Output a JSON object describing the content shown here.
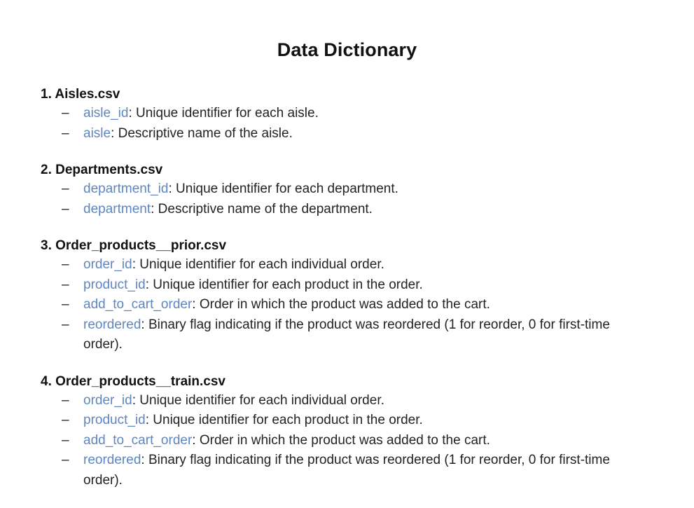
{
  "document": {
    "title": "Data Dictionary",
    "sections": [
      {
        "heading": "1. Aisles.csv",
        "fields": [
          {
            "name": "aisle_id",
            "description": ": Unique identifier for each aisle."
          },
          {
            "name": "aisle",
            "description": ": Descriptive name of the aisle."
          }
        ]
      },
      {
        "heading": "2. Departments.csv",
        "fields": [
          {
            "name": "department_id",
            "description": ": Unique identifier for each department."
          },
          {
            "name": "department",
            "description": ": Descriptive name of the department."
          }
        ]
      },
      {
        "heading": "3. Order_products__prior.csv",
        "fields": [
          {
            "name": "order_id",
            "description": ": Unique identifier for each individual order."
          },
          {
            "name": "product_id",
            "description": ": Unique identifier for each product in the order."
          },
          {
            "name": "add_to_cart_order",
            "description": ": Order in which the product was added to the cart."
          },
          {
            "name": "reordered",
            "description": ": Binary flag indicating if the product was reordered (1 for reorder, 0 for first-time order)."
          }
        ]
      },
      {
        "heading": "4. Order_products__train.csv",
        "fields": [
          {
            "name": "order_id",
            "description": ": Unique identifier for each individual order."
          },
          {
            "name": "product_id",
            "description": ": Unique identifier for each product in the order."
          },
          {
            "name": "add_to_cart_order",
            "description": ": Order in which the product was added to the cart."
          },
          {
            "name": "reordered",
            "description": ": Binary flag indicating if the product was reordered (1 for reorder, 0 for first-time order)."
          }
        ]
      }
    ]
  },
  "bullet": "–",
  "colors": {
    "field_name": "#5f86c0",
    "text": "#232323",
    "heading": "#111111"
  }
}
